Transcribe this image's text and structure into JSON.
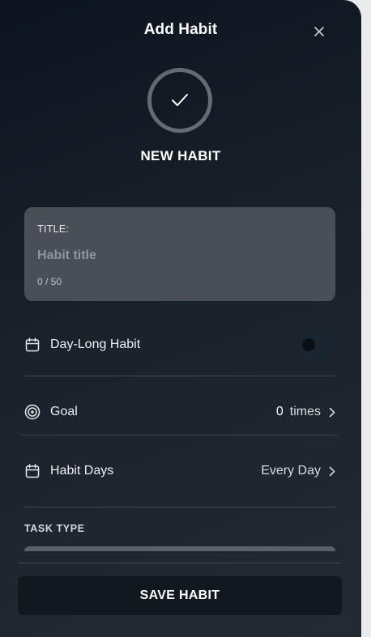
{
  "header": {
    "title": "Add Habit",
    "close_icon": "close-icon"
  },
  "hero": {
    "icon": "check-icon",
    "label": "NEW HABIT"
  },
  "title_field": {
    "label": "TITLE:",
    "placeholder": "Habit title",
    "value": "",
    "counter": "0 / 50"
  },
  "day_long": {
    "icon": "calendar-icon",
    "label": "Day-Long Habit",
    "enabled": false
  },
  "goal": {
    "icon": "target-icon",
    "label": "Goal",
    "count": "0",
    "unit": "times"
  },
  "habit_days": {
    "icon": "calendar-icon",
    "label": "Habit Days",
    "value": "Every Day"
  },
  "task_type": {
    "label": "TASK TYPE"
  },
  "footer": {
    "save_label": "SAVE HABIT"
  }
}
